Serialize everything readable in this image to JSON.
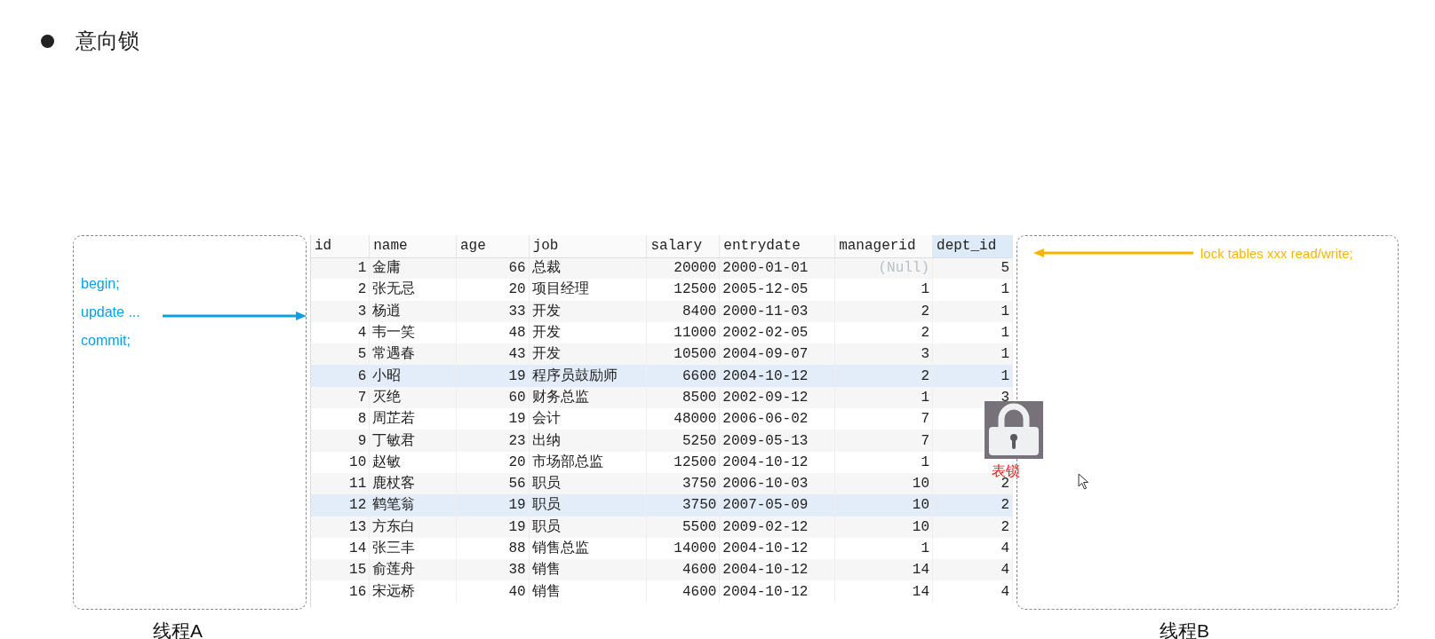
{
  "heading": {
    "text": "意向锁"
  },
  "thread_a": {
    "label": "线程A",
    "statements": [
      "begin;",
      "update ...",
      "commit;"
    ]
  },
  "thread_b": {
    "label": "线程B",
    "statement": "lock tables xxx read/write;"
  },
  "table": {
    "columns": [
      {
        "label": "id",
        "kind": "number",
        "selected": false
      },
      {
        "label": "name",
        "kind": "text",
        "selected": false
      },
      {
        "label": "age",
        "kind": "number",
        "selected": false
      },
      {
        "label": "job",
        "kind": "text",
        "selected": false
      },
      {
        "label": "salary",
        "kind": "number",
        "selected": false
      },
      {
        "label": "entrydate",
        "kind": "text",
        "selected": false
      },
      {
        "label": "managerid",
        "kind": "number",
        "selected": false
      },
      {
        "label": "dept_id",
        "kind": "number",
        "selected": true
      }
    ],
    "rows": [
      {
        "selected": false,
        "cells": [
          "1",
          "金庸",
          "66",
          "总裁",
          "20000",
          "2000-01-01",
          {
            "text": "(Null)",
            "kind": "null"
          },
          "5"
        ]
      },
      {
        "selected": false,
        "cells": [
          "2",
          "张无忌",
          "20",
          "项目经理",
          "12500",
          "2005-12-05",
          "1",
          "1"
        ]
      },
      {
        "selected": false,
        "cells": [
          "3",
          "杨逍",
          "33",
          "开发",
          "8400",
          "2000-11-03",
          "2",
          "1"
        ]
      },
      {
        "selected": false,
        "cells": [
          "4",
          "韦一笑",
          "48",
          "开发",
          "11000",
          "2002-02-05",
          "2",
          "1"
        ]
      },
      {
        "selected": false,
        "cells": [
          "5",
          "常遇春",
          "43",
          "开发",
          "10500",
          "2004-09-07",
          "3",
          "1"
        ]
      },
      {
        "selected": true,
        "cells": [
          "6",
          "小昭",
          "19",
          "程序员鼓励师",
          "6600",
          "2004-10-12",
          "2",
          "1"
        ]
      },
      {
        "selected": false,
        "cells": [
          "7",
          "灭绝",
          "60",
          "财务总监",
          "8500",
          "2002-09-12",
          "1",
          "3"
        ]
      },
      {
        "selected": false,
        "cells": [
          "8",
          "周芷若",
          "19",
          "会计",
          "48000",
          "2006-06-02",
          "7",
          null
        ]
      },
      {
        "selected": false,
        "cells": [
          "9",
          "丁敏君",
          "23",
          "出纳",
          "5250",
          "2009-05-13",
          "7",
          null
        ]
      },
      {
        "selected": false,
        "cells": [
          "10",
          "赵敏",
          "20",
          "市场部总监",
          "12500",
          "2004-10-12",
          "1",
          null
        ]
      },
      {
        "selected": false,
        "cells": [
          "11",
          "鹿杖客",
          "56",
          "职员",
          "3750",
          "2006-10-03",
          "10",
          "2"
        ]
      },
      {
        "selected": true,
        "cells": [
          "12",
          "鹤笔翁",
          "19",
          "职员",
          "3750",
          "2007-05-09",
          "10",
          "2"
        ]
      },
      {
        "selected": false,
        "cells": [
          "13",
          "方东白",
          "19",
          "职员",
          "5500",
          "2009-02-12",
          "10",
          "2"
        ]
      },
      {
        "selected": false,
        "cells": [
          "14",
          "张三丰",
          "88",
          "销售总监",
          "14000",
          "2004-10-12",
          "1",
          "4"
        ]
      },
      {
        "selected": false,
        "cells": [
          "15",
          "俞莲舟",
          "38",
          "销售",
          "4600",
          "2004-10-12",
          "14",
          "4"
        ]
      },
      {
        "selected": false,
        "cells": [
          "16",
          "宋远桥",
          "40",
          "销售",
          "4600",
          "2004-10-12",
          "14",
          "4"
        ]
      }
    ]
  },
  "lock_badge": {
    "label": "表锁"
  }
}
